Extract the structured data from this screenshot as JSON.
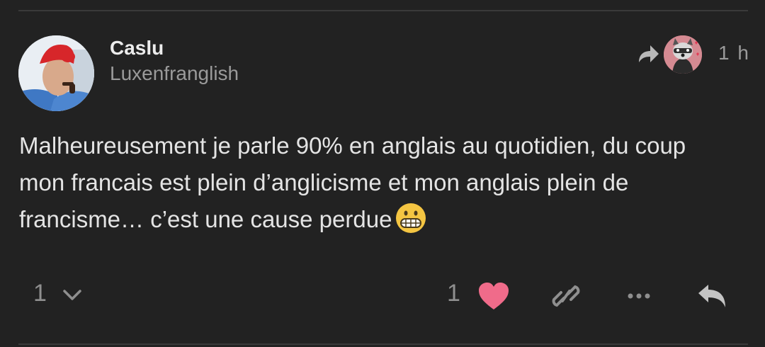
{
  "post": {
    "author": {
      "name": "Caslu",
      "handle": "Luxenfranglish"
    },
    "time_ago": "1 h",
    "lines": [
      "Malheureusement je parle 90% en anglais au quotidien, du coup",
      "mon francais est plein d’anglicisme et mon anglais plein de",
      "francisme… c’est une cause perdue"
    ],
    "emoji": "grimacing-face"
  },
  "actions": {
    "replies_count": "1",
    "likes_count": "1"
  },
  "colors": {
    "background": "#222222",
    "heart": "#f06b8a",
    "muted": "#8f8f8f",
    "text": "#e4e4e4"
  },
  "icons": [
    "share-arrow-icon",
    "chevron-down-icon",
    "heart-icon",
    "link-icon",
    "more-icon",
    "reply-icon"
  ]
}
